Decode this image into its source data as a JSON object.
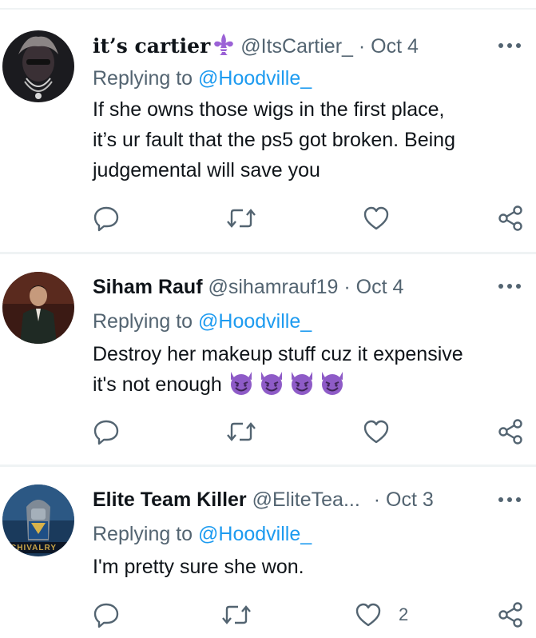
{
  "replies": [
    {
      "display_name": "it’s cartier",
      "handle": "@ItsCartier_",
      "separator": "·",
      "date": "Oct 4",
      "replying_prefix": "Replying to ",
      "replying_to": "@Hoodville_",
      "text_line1": "If she owns those wigs in the first place,",
      "text_line2": "it’s ur fault that the ps5 got broken. Being",
      "text_line3": "judgemental will save you",
      "likes": ""
    },
    {
      "display_name": "Siham Rauf",
      "handle": "@sihamrauf19",
      "separator": "·",
      "date": "Oct 4",
      "replying_prefix": "Replying to ",
      "replying_to": "@Hoodville_",
      "text_line1": "Destroy her makeup stuff cuz it expensive",
      "text_line2": "it's not enough",
      "likes": ""
    },
    {
      "display_name": "Elite Team Killer",
      "handle": "@EliteTea...",
      "separator": "·",
      "date": "Oct 3",
      "replying_prefix": "Replying to ",
      "replying_to": "@Hoodville_",
      "text_line1": "I'm pretty sure she won.",
      "likes": "2",
      "avatar_text": "CHIVALRY"
    }
  ],
  "colors": {
    "text": "#0f1419",
    "secondary": "#536471",
    "link": "#1d9bf0",
    "divider": "#eff3f4",
    "emoji_purple": "#8e5bc7"
  },
  "icons": [
    "more-icon",
    "reply-icon",
    "retweet-icon",
    "like-icon",
    "share-icon",
    "fleur-de-lis-icon",
    "smiling-devil-emoji"
  ]
}
